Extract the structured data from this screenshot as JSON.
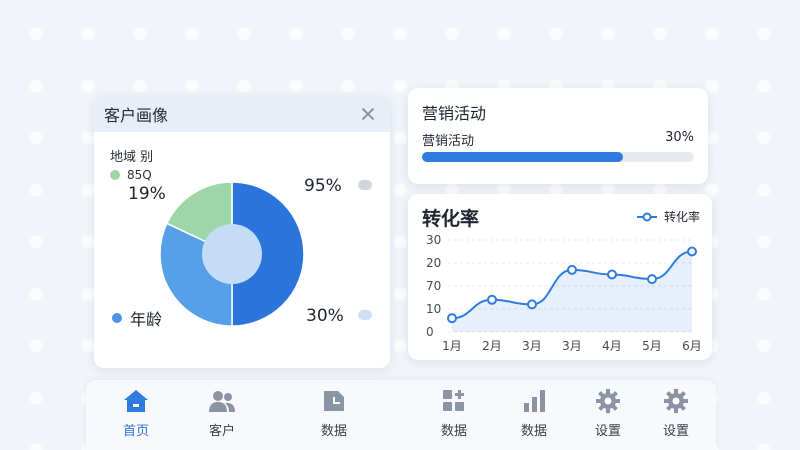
{
  "customer_card": {
    "title": "客户画像",
    "region_label": "地域 别",
    "green_legend_label": "85Q",
    "green_pct": "19%",
    "blue_top_pct": "95%",
    "blue_bottom_pct": "30%",
    "age_label": "年龄"
  },
  "marketing": {
    "title": "营销活动",
    "label": "营销活动",
    "pct_label": "30%",
    "progress": 0.74
  },
  "conversion": {
    "title": "转化率",
    "legend": "转化率"
  },
  "nav": {
    "items": [
      {
        "label": "首页",
        "icon": "home-icon"
      },
      {
        "label": "客户",
        "icon": "users-icon"
      },
      {
        "label": "数据",
        "icon": "doc-chart-icon"
      },
      {
        "label": "数据",
        "icon": "grid-plus-icon"
      },
      {
        "label": "数据",
        "icon": "bar-chart-icon"
      },
      {
        "label": "设置",
        "icon": "gear-icon"
      },
      {
        "label": "设置",
        "icon": "gear-icon"
      }
    ]
  },
  "colors": {
    "accent": "#2f7be0",
    "pie_dark": "#2a74dc",
    "pie_mid": "#56a0ea",
    "pie_green": "#9fd6a8",
    "pie_center": "#c4dcf6"
  },
  "chart_data": [
    {
      "type": "pie",
      "values": [
        50,
        32,
        18
      ],
      "colors": [
        "#2a74dc",
        "#56a0ea",
        "#9fd6a8"
      ],
      "labels": [
        "95%",
        "30%",
        "19%"
      ]
    },
    {
      "type": "line",
      "title": "转化率",
      "categories": [
        "1月",
        "2月",
        "3月",
        "3月",
        "4月",
        "5月",
        "6月"
      ],
      "y_ticks": [
        "30",
        "20",
        "70",
        "10",
        "0"
      ],
      "series": [
        {
          "name": "转化率",
          "values": [
            0.6,
            1.4,
            1.2,
            2.7,
            2.5,
            2.3,
            3.5
          ]
        }
      ],
      "ylim": [
        0,
        4
      ],
      "grid": true
    }
  ]
}
